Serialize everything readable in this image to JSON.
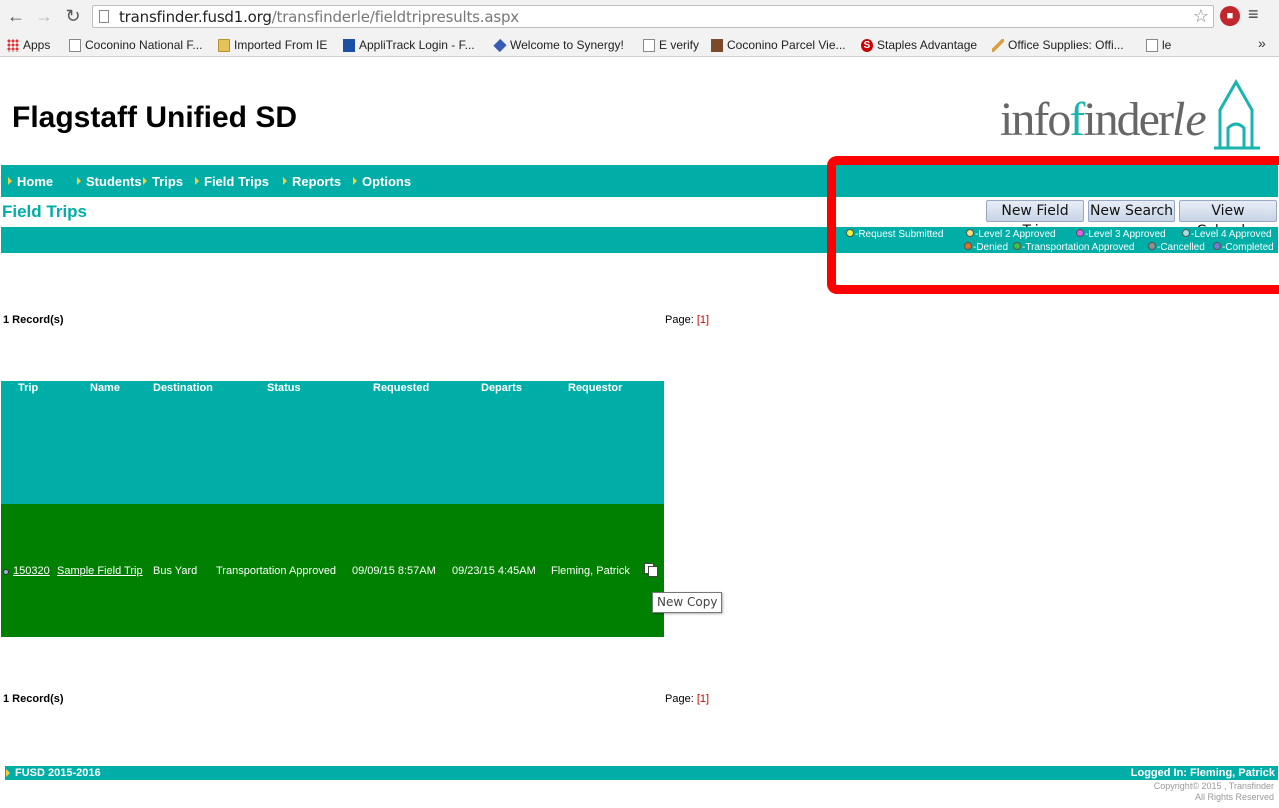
{
  "browser": {
    "url_host": "transfinder.fusd1.org",
    "url_path": "/transfinderle/fieldtripresults.aspx",
    "bookmarks": [
      {
        "label": "Apps",
        "icon": "apps-grid-icon"
      },
      {
        "label": "Coconino National F...",
        "icon": "page-icon"
      },
      {
        "label": "Imported From IE",
        "icon": "folder-icon"
      },
      {
        "label": "AppliTrack Login - F...",
        "icon": "applitrack-icon"
      },
      {
        "label": "Welcome to Synergy!",
        "icon": "synergy-icon"
      },
      {
        "label": "E verify",
        "icon": "page-icon"
      },
      {
        "label": "Coconino Parcel Vie...",
        "icon": "parcel-icon"
      },
      {
        "label": "Staples Advantage",
        "icon": "staples-icon"
      },
      {
        "label": "Office Supplies: Offi...",
        "icon": "pencil-icon"
      },
      {
        "label": "le",
        "icon": "page-icon"
      }
    ],
    "more": "»"
  },
  "header": {
    "title": "Flagstaff Unified SD",
    "logo_info": "info",
    "logo_f": "f",
    "logo_inder": "inder",
    "logo_le": "le"
  },
  "nav": [
    {
      "label": "Home"
    },
    {
      "label": "Students"
    },
    {
      "label": "Trips"
    },
    {
      "label": "Field Trips"
    },
    {
      "label": "Reports"
    },
    {
      "label": "Options"
    }
  ],
  "section_title": "Field Trips",
  "buttons": {
    "new_field_trip": "New Field Trip",
    "new_search": "New Search",
    "view_calendar": "View Calendar"
  },
  "legend": [
    {
      "label": "-Request Submitted",
      "color": "#f5f53a"
    },
    {
      "label": "-Level 2 Approved",
      "color": "#f5e07a"
    },
    {
      "label": "-Level 3 Approved",
      "color": "#e060e0"
    },
    {
      "label": "-Level 4 Approved",
      "color": "#a0e0e0"
    },
    {
      "label": "-Denied",
      "color": "#e07020"
    },
    {
      "label": "-Transportation Approved",
      "color": "#40c040"
    },
    {
      "label": "-Cancelled",
      "color": "#909090"
    },
    {
      "label": "-Completed",
      "color": "#7080d0"
    }
  ],
  "records_top": "1 Record(s)",
  "records_bottom": "1 Record(s)",
  "page_label": "Page:",
  "page_value": "[1]",
  "table": {
    "columns": [
      "Trip",
      "Name",
      "Destination",
      "Status",
      "Requested",
      "Departs",
      "Requestor"
    ],
    "row": {
      "trip": "150320",
      "name": "Sample Field Trip",
      "destination": "Bus Yard",
      "status": "Transportation Approved",
      "requested": "09/09/15 8:57AM",
      "departs": "09/23/15 4:45AM",
      "requestor": "Fleming, Patrick"
    },
    "tooltip": "New Copy"
  },
  "footer": {
    "left": "FUSD 2015-2016",
    "right": "Logged In: Fleming, Patrick",
    "copyright": "Copyright© 2015 , Transfinder",
    "rights": "All Rights Reserved"
  }
}
